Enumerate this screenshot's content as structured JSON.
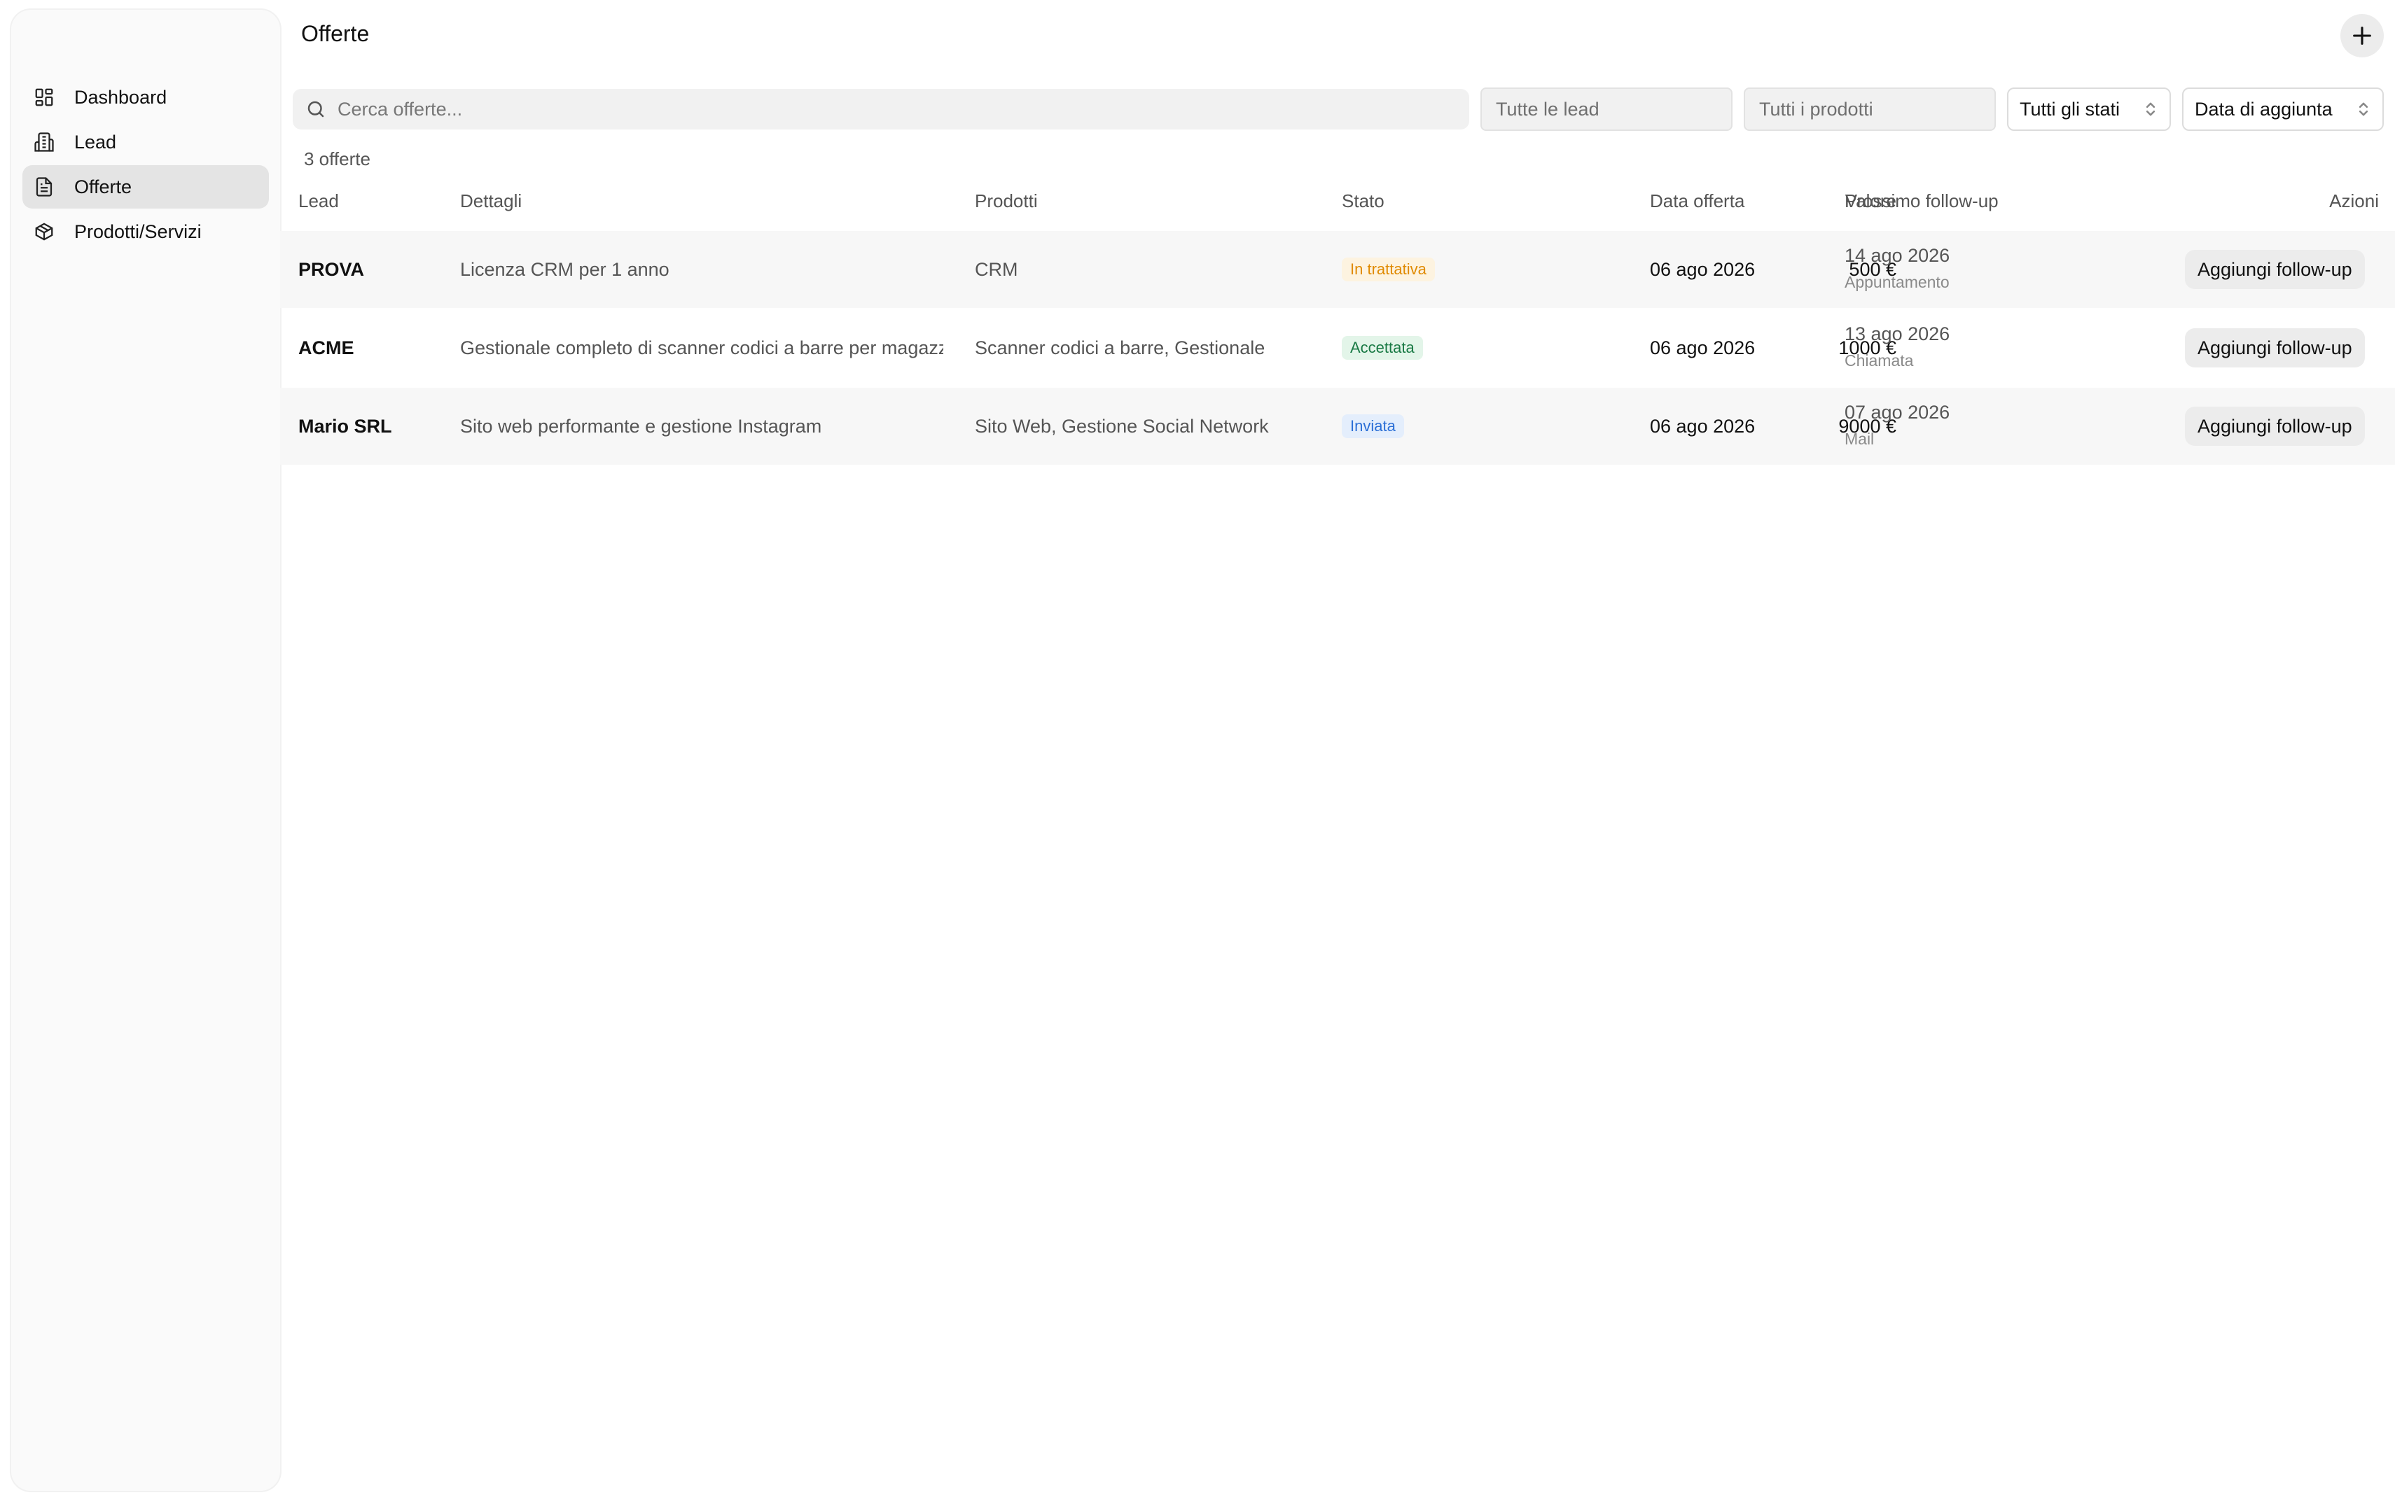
{
  "sidebar": {
    "items": [
      {
        "label": "Dashboard",
        "icon": "dashboard-grid-icon",
        "active": false
      },
      {
        "label": "Lead",
        "icon": "building-icon",
        "active": false
      },
      {
        "label": "Offerte",
        "icon": "document-icon",
        "active": true
      },
      {
        "label": "Prodotti/Servizi",
        "icon": "package-box-icon",
        "active": false
      }
    ]
  },
  "header": {
    "title": "Offerte",
    "add_icon": "plus-icon"
  },
  "toolbar": {
    "search_placeholder": "Cerca offerte...",
    "lead_filter_placeholder": "Tutte le lead",
    "product_filter_placeholder": "Tutti i prodotti",
    "status_select": "Tutti gli stati",
    "sort_select": "Data di aggiunta"
  },
  "summary": {
    "count_label": "3 offerte"
  },
  "table": {
    "columns": {
      "lead": "Lead",
      "details": "Dettagli",
      "products": "Prodotti",
      "status": "Stato",
      "value": "Valore",
      "offer_date": "Data offerta",
      "next_followup": "Prossimo follow-up",
      "actions": "Azioni"
    },
    "rows": [
      {
        "lead": "PROVA",
        "details": "Licenza CRM per 1 anno",
        "products": "CRM",
        "status": "In trattativa",
        "value": "500 €",
        "offer_date": "06 ago 2026",
        "followup_date": "14 ago 2026",
        "followup_type": "Appuntamento",
        "action": "Aggiungi follow-up"
      },
      {
        "lead": "ACME",
        "details": "Gestionale completo di scanner codici a barre per magazzino",
        "products": "Scanner codici a barre, Gestionale",
        "status": "Accettata",
        "value": "1000 €",
        "offer_date": "06 ago 2026",
        "followup_date": "13 ago 2026",
        "followup_type": "Chiamata",
        "action": "Aggiungi follow-up"
      },
      {
        "lead": "Mario SRL",
        "details": "Sito web performante e gestione Instagram",
        "products": "Sito Web, Gestione Social Network",
        "status": "Inviata",
        "value": "9000 €",
        "offer_date": "06 ago 2026",
        "followup_date": "07 ago 2026",
        "followup_type": "Mail",
        "action": "Aggiungi follow-up"
      }
    ]
  },
  "colors": {
    "status_in_trattativa_text": "#e08a00",
    "status_in_trattativa_bg": "#fdf3e0",
    "status_accettata_text": "#1a7a45",
    "status_accettata_bg": "#e3f5e9",
    "status_inviata_text": "#2b6fd6",
    "status_inviata_bg": "#e4eefc"
  }
}
